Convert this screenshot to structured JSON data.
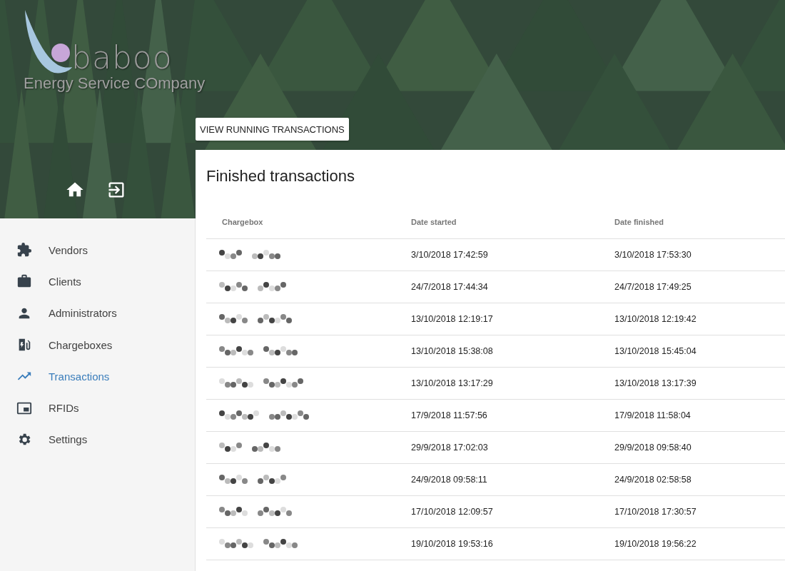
{
  "logo": {
    "wordmark": "baboo",
    "tagline": "Energy Service COmpany"
  },
  "sidebar": {
    "items": [
      {
        "label": "Vendors",
        "selected": false
      },
      {
        "label": "Clients",
        "selected": false
      },
      {
        "label": "Administrators",
        "selected": false
      },
      {
        "label": "Chargeboxes",
        "selected": false
      },
      {
        "label": "Transactions",
        "selected": true
      },
      {
        "label": "RFIDs",
        "selected": false
      },
      {
        "label": "Settings",
        "selected": false
      }
    ]
  },
  "running_button": "VIEW RUNNING TRANSACTIONS",
  "card": {
    "title": "Finished transactions"
  },
  "table": {
    "columns": [
      "Chargebox",
      "Date started",
      "Date finished"
    ],
    "rows": [
      {
        "chargebox_redacted": true,
        "date_started": "3/10/2018 17:42:59",
        "date_finished": "3/10/2018 17:53:30"
      },
      {
        "chargebox_redacted": true,
        "date_started": "24/7/2018 17:44:34",
        "date_finished": "24/7/2018 17:49:25"
      },
      {
        "chargebox_redacted": true,
        "date_started": "13/10/2018 12:19:17",
        "date_finished": "13/10/2018 12:19:42"
      },
      {
        "chargebox_redacted": true,
        "date_started": "13/10/2018 15:38:08",
        "date_finished": "13/10/2018 15:45:04"
      },
      {
        "chargebox_redacted": true,
        "date_started": "13/10/2018 13:17:29",
        "date_finished": "13/10/2018 13:17:39"
      },
      {
        "chargebox_redacted": true,
        "date_started": "17/9/2018 11:57:56",
        "date_finished": "17/9/2018 11:58:04"
      },
      {
        "chargebox_redacted": true,
        "date_started": "29/9/2018 17:02:03",
        "date_finished": "29/9/2018 09:58:40"
      },
      {
        "chargebox_redacted": true,
        "date_started": "24/9/2018 09:58:11",
        "date_finished": "24/9/2018 02:58:58"
      },
      {
        "chargebox_redacted": true,
        "date_started": "17/10/2018 12:09:57",
        "date_finished": "17/10/2018 17:30:57"
      },
      {
        "chargebox_redacted": true,
        "date_started": "19/10/2018 19:53:16",
        "date_finished": "19/10/2018 19:56:22"
      }
    ]
  }
}
